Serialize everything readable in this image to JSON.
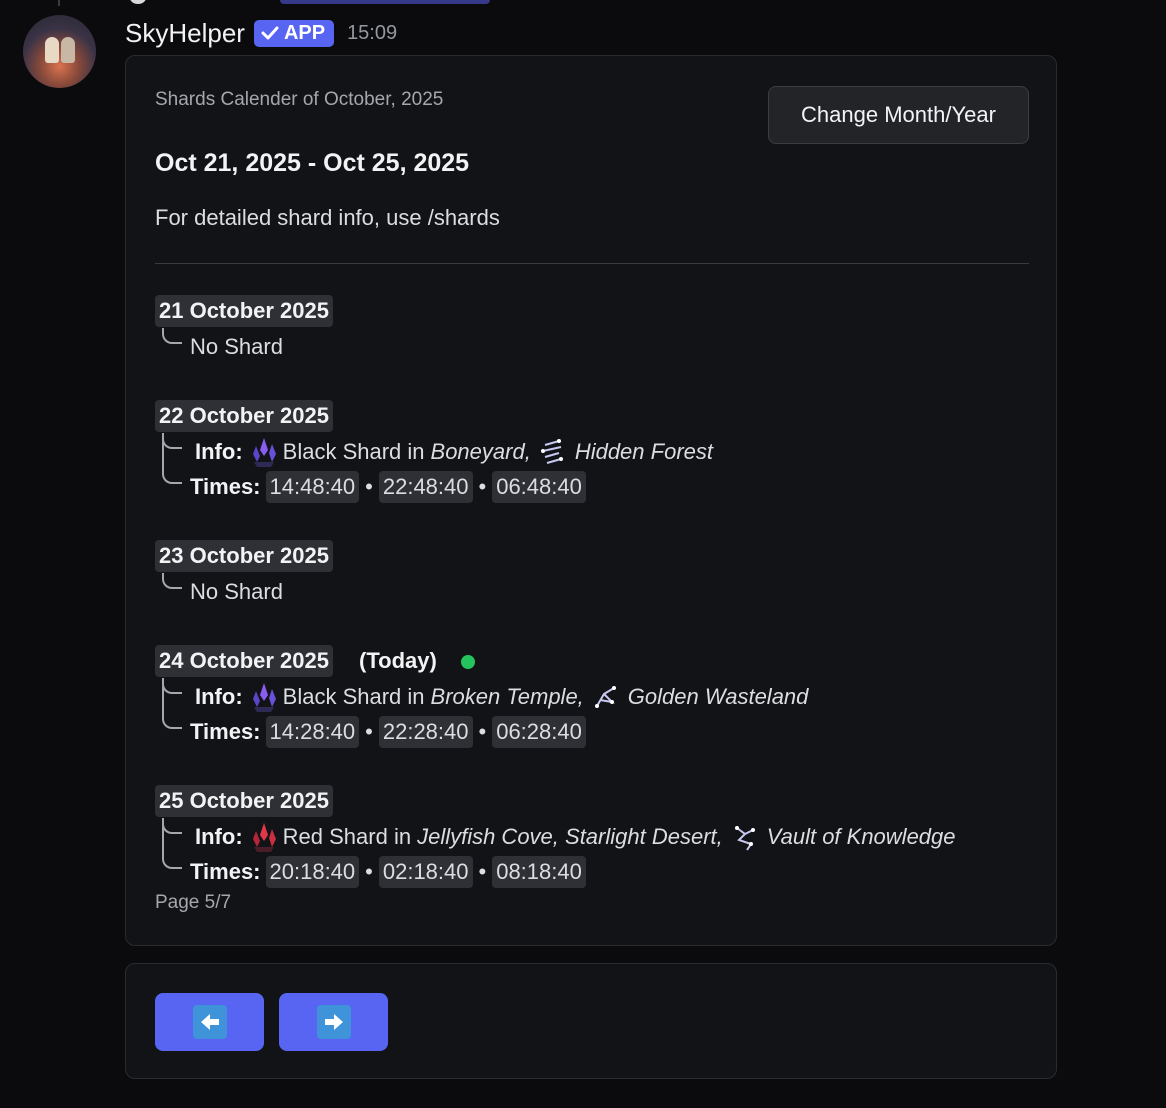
{
  "message": {
    "username": "SkyHelper",
    "app_tag": "APP",
    "timestamp": "15:09"
  },
  "embed": {
    "small_title": "Shards Calender of October, 2025",
    "range_title": "Oct 21, 2025 - Oct 25, 2025",
    "description": "For detailed shard info, use /shards",
    "change_button": "Change Month/Year",
    "page": "Page 5/7",
    "labels": {
      "info": "Info:",
      "times": "Times:",
      "separator": "•"
    },
    "days": [
      {
        "date": "21 October 2025",
        "no_shard": "No Shard"
      },
      {
        "date": "22 October 2025",
        "shard_color": "#8a5cf0",
        "shard_text": "Black Shard in",
        "location": "Boneyard,",
        "realm": "Hidden Forest",
        "times": [
          "14:48:40",
          "22:48:40",
          "06:48:40"
        ]
      },
      {
        "date": "23 October 2025",
        "no_shard": "No Shard"
      },
      {
        "date": "24 October 2025",
        "today": "(Today)",
        "shard_color": "#8a5cf0",
        "shard_text": "Black Shard in",
        "location": "Broken Temple,",
        "realm": "Golden Wasteland",
        "times": [
          "14:28:40",
          "22:28:40",
          "06:28:40"
        ]
      },
      {
        "date": "25 October 2025",
        "shard_color": "#e0384a",
        "shard_text": "Red Shard in",
        "location": "Jellyfish Cove, Starlight Desert,",
        "realm": "Vault of Knowledge",
        "times": [
          "20:18:40",
          "02:18:40",
          "08:18:40"
        ]
      }
    ]
  },
  "buttons": {
    "prev_icon": "arrow-left-icon",
    "next_icon": "arrow-right-icon"
  },
  "colors": {
    "accent": "#5865f2",
    "today_dot": "#23c45e"
  }
}
